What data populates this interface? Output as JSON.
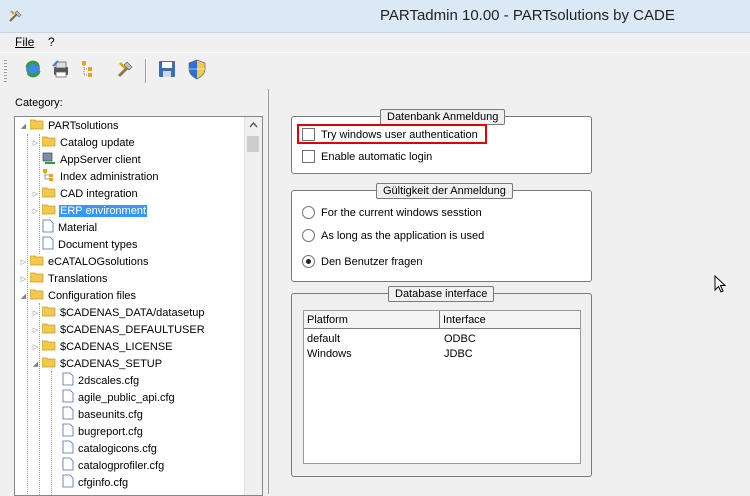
{
  "window": {
    "title": "PARTadmin 10.00 - PARTsolutions by CADE"
  },
  "menu": {
    "items": [
      "File",
      "?"
    ]
  },
  "toolbar": {
    "icons": [
      "refresh-icon",
      "printer-icon",
      "hierarchy-icon",
      "tools-icon",
      "save-icon",
      "shield-icon"
    ]
  },
  "left": {
    "category_label": "Category:",
    "tree": [
      {
        "label": "PARTsolutions",
        "icon": "folder-icon",
        "expanded": true
      },
      {
        "label": "Catalog update",
        "icon": "folder-icon",
        "expanded": false
      },
      {
        "label": "AppServer client",
        "icon": "server-icon",
        "expanded": null
      },
      {
        "label": "Index administration",
        "icon": "index-icon",
        "expanded": null
      },
      {
        "label": "CAD integration",
        "icon": "folder-icon",
        "expanded": false
      },
      {
        "label": "ERP environment",
        "icon": "folder-icon",
        "expanded": false,
        "selected": true
      },
      {
        "label": "Material",
        "icon": "document-icon",
        "expanded": null
      },
      {
        "label": "Document types",
        "icon": "document-icon",
        "expanded": null
      },
      {
        "label": "eCATALOGsolutions",
        "icon": "folder-icon",
        "expanded": false
      },
      {
        "label": "Translations",
        "icon": "folder-icon",
        "expanded": false
      },
      {
        "label": "Configuration files",
        "icon": "folder-icon",
        "expanded": true
      },
      {
        "label": "$CADENAS_DATA/datasetup",
        "icon": "folder-icon",
        "expanded": false
      },
      {
        "label": "$CADENAS_DEFAULTUSER",
        "icon": "folder-icon",
        "expanded": false
      },
      {
        "label": "$CADENAS_LICENSE",
        "icon": "folder-icon",
        "expanded": false
      },
      {
        "label": "$CADENAS_SETUP",
        "icon": "folder-icon",
        "expanded": true
      },
      {
        "label": "2dscales.cfg",
        "icon": "document-icon",
        "expanded": null
      },
      {
        "label": "agile_public_api.cfg",
        "icon": "document-icon",
        "expanded": null
      },
      {
        "label": "baseunits.cfg",
        "icon": "document-icon",
        "expanded": null
      },
      {
        "label": "bugreport.cfg",
        "icon": "document-icon",
        "expanded": null
      },
      {
        "label": "catalogicons.cfg",
        "icon": "document-icon",
        "expanded": null
      },
      {
        "label": "catalogprofiler.cfg",
        "icon": "document-icon",
        "expanded": null
      },
      {
        "label": "cfginfo.cfg",
        "icon": "document-icon",
        "expanded": null
      }
    ]
  },
  "right": {
    "login_group": {
      "title": "Datenbank Anmeldung",
      "try_windows_auth": {
        "label": "Try windows user authentication",
        "checked": false
      },
      "auto_login": {
        "label": "Enable automatic login",
        "checked": false
      }
    },
    "validity_group": {
      "title": "Gültigkeit der Anmeldung",
      "options": [
        {
          "label": "For the current windows sesstion",
          "selected": false
        },
        {
          "label": "As long as the application is used",
          "selected": false
        },
        {
          "label": "Den Benutzer fragen",
          "selected": true
        }
      ]
    },
    "db_interface_group": {
      "title": "Database interface",
      "columns": [
        "Platform",
        "Interface"
      ],
      "rows": [
        [
          "default",
          "ODBC"
        ],
        [
          "Windows",
          "JDBC"
        ]
      ]
    }
  },
  "colors": {
    "selection": "#3399ff",
    "highlight": "#e00000",
    "folder": "#f2c94c"
  }
}
